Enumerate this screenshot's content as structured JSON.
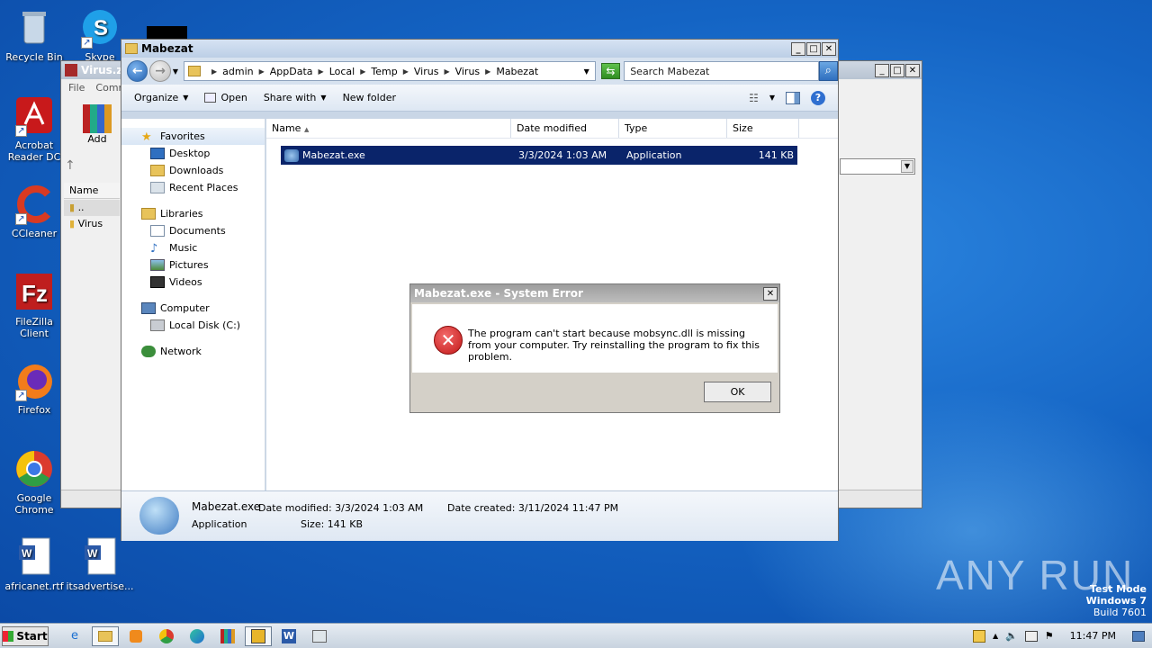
{
  "desktop_icons": [
    {
      "label": "Recycle Bin",
      "icon": "recycle-bin-icon"
    },
    {
      "label": "Skype",
      "icon": "skype-icon"
    },
    {
      "label": "Acrobat Reader DC",
      "icon": "acrobat-icon"
    },
    {
      "label": "CCleaner",
      "icon": "ccleaner-icon"
    },
    {
      "label": "FileZilla Client",
      "icon": "filezilla-icon"
    },
    {
      "label": "Firefox",
      "icon": "firefox-icon"
    },
    {
      "label": "Google Chrome",
      "icon": "chrome-icon"
    },
    {
      "label": "africanet.rtf",
      "icon": "word-doc-icon"
    },
    {
      "label": "itsadvertise...",
      "icon": "word-doc-icon"
    }
  ],
  "zip_window": {
    "title": "Virus.zip",
    "menu": [
      "File",
      "Comm"
    ],
    "add_label": "Add",
    "col_name": "Name",
    "rows": [
      "..",
      "Virus"
    ]
  },
  "explorer": {
    "title": "Mabezat",
    "breadcrumbs": [
      "admin",
      "AppData",
      "Local",
      "Temp",
      "Virus",
      "Virus",
      "Mabezat"
    ],
    "search_placeholder": "Search Mabezat",
    "toolbar": {
      "organize": "Organize",
      "open": "Open",
      "share": "Share with",
      "new_folder": "New folder"
    },
    "nav": {
      "favorites": "Favorites",
      "desktop": "Desktop",
      "downloads": "Downloads",
      "recent": "Recent Places",
      "libraries": "Libraries",
      "documents": "Documents",
      "music": "Music",
      "pictures": "Pictures",
      "videos": "Videos",
      "computer": "Computer",
      "local_disk": "Local Disk (C:)",
      "network": "Network"
    },
    "columns": {
      "name": "Name",
      "date": "Date modified",
      "type": "Type",
      "size": "Size"
    },
    "file": {
      "name": "Mabezat.exe",
      "date": "3/3/2024 1:03 AM",
      "type": "Application",
      "size": "141 KB"
    },
    "details": {
      "name": "Mabezat.exe",
      "date_modified_label": "Date modified:",
      "date_modified": "3/3/2024 1:03 AM",
      "date_created_label": "Date created:",
      "date_created": "3/11/2024 11:47 PM",
      "type": "Application",
      "size_label": "Size:",
      "size": "141 KB"
    }
  },
  "dialog": {
    "title": "Mabezat.exe - System Error",
    "message": "The program can't start because mobsync.dll is missing from your computer. Try reinstalling the program to fix this problem.",
    "ok": "OK"
  },
  "taskbar": {
    "start": "Start",
    "clock": "11:47 PM"
  },
  "watermark": "ANY RUN",
  "testmode": {
    "line1": "Test Mode",
    "line2": "Windows 7",
    "line3": "Build 7601"
  }
}
